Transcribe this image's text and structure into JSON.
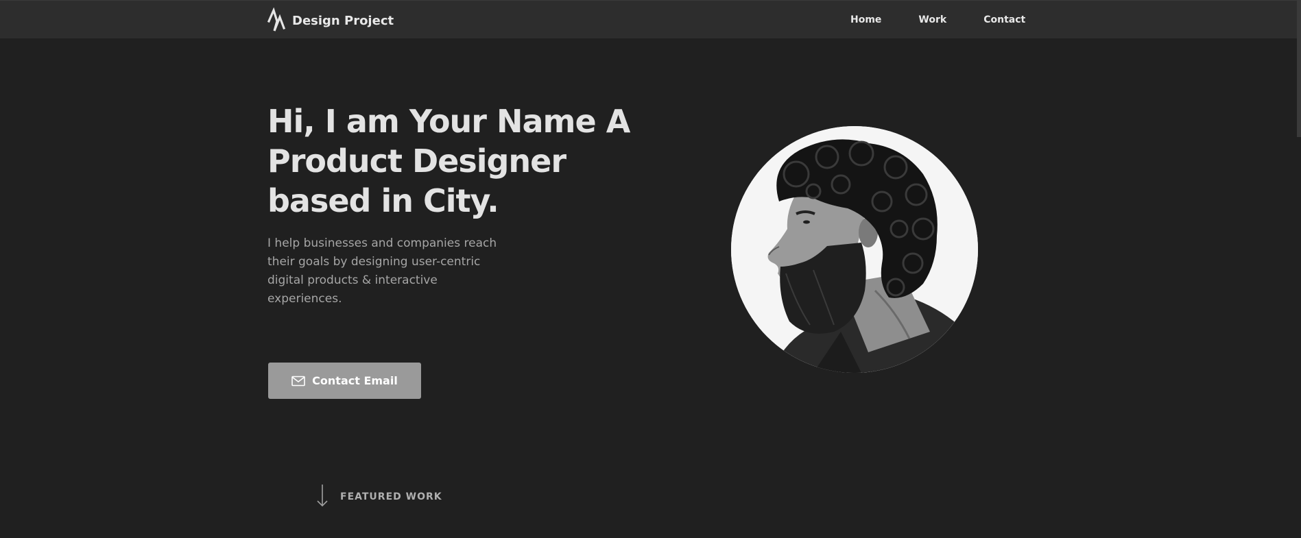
{
  "header": {
    "brand_name": "Design Project",
    "logo_icon": "zigzag-logo-icon",
    "nav": [
      {
        "label": "Home"
      },
      {
        "label": "Work"
      },
      {
        "label": "Contact"
      }
    ]
  },
  "hero": {
    "title_lines": [
      "Hi, I am Your Name A",
      "Product Designer",
      "based in City."
    ],
    "description_lines": [
      "I help businesses and companies reach",
      "their goals by designing user-centric",
      "digital products & interactive",
      "experiences."
    ],
    "cta": {
      "label": "Contact Email",
      "icon": "mail-icon"
    },
    "portrait": {
      "icon": "portrait-photo"
    }
  },
  "featured": {
    "label": "FEATURED WORK",
    "icon": "arrow-down-icon"
  },
  "colors": {
    "background": "#202020",
    "navbar": "#2d2d2d",
    "title_text": "#e3e3e3",
    "body_text": "#a6a6a6",
    "button_bg": "#9a9a9a"
  }
}
